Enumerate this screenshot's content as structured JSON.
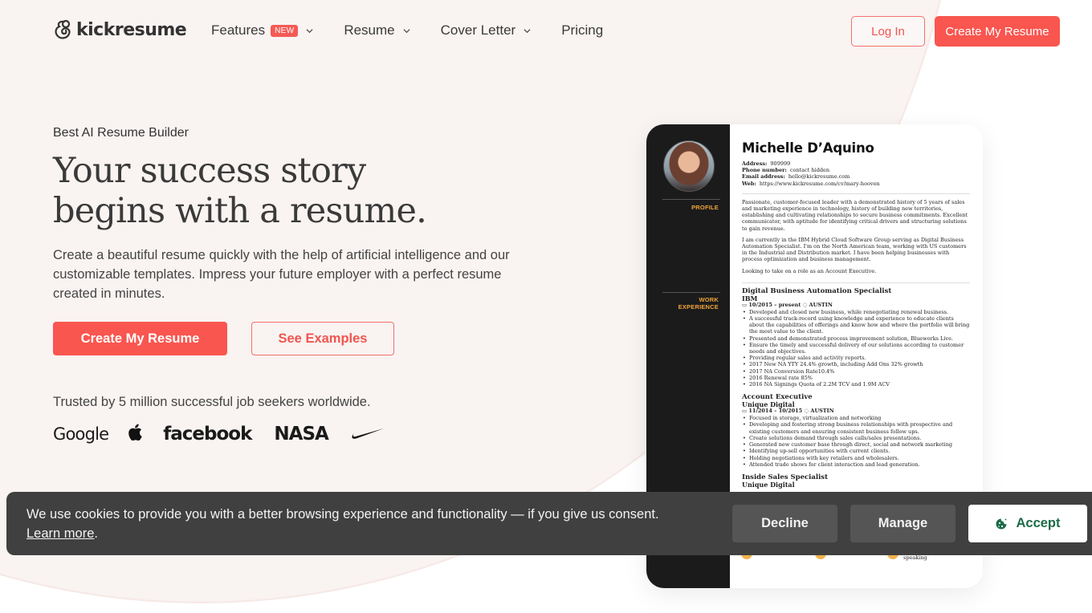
{
  "header": {
    "logo_text": "kickresume",
    "nav": [
      {
        "label": "Features",
        "badge": "NEW",
        "has_dropdown": true
      },
      {
        "label": "Resume",
        "has_dropdown": true
      },
      {
        "label": "Cover Letter",
        "has_dropdown": true
      },
      {
        "label": "Pricing",
        "has_dropdown": false
      }
    ],
    "login_label": "Log In",
    "create_label": "Create My Resume"
  },
  "hero": {
    "eyebrow": "Best AI Resume Builder",
    "headline_line1": "Your success story",
    "headline_line2": "begins with a resume.",
    "subtext": "Create a beautiful resume quickly with the help of artificial intelligence and our customizable templates. Impress your future employer with a perfect resume created in minutes.",
    "primary_cta": "Create My Resume",
    "secondary_cta": "See Examples",
    "trusted_text": "Trusted by 5 million successful job seekers worldwide.",
    "brands": [
      "Google",
      "Apple",
      "facebook",
      "NASA",
      "Nike"
    ]
  },
  "resume": {
    "name": "Michelle D’Aquino",
    "contact": [
      {
        "label": "Address:",
        "value": "909999"
      },
      {
        "label": "Phone number:",
        "value": "contact hidden"
      },
      {
        "label": "Email address:",
        "value": "hello@kickresume.com"
      },
      {
        "label": "Web:",
        "value": "https://www.kickresume.com/cv/mary-hooven"
      }
    ],
    "sections": {
      "profile": "PROFILE",
      "work_1": "WORK",
      "work_2": "EXPERIENCE"
    },
    "profile_paragraphs": [
      "Passionate, customer-focused leader with a demonstrated history of 5 years of sales and marketing experience in technology, history of building new territories, establishing and cultivating relationships to secure business commitments. Excellent communicator, with aptitude for identifying critical drivers and structuring solutions to gain revenue.",
      "I am currently in the IBM Hybrid Cloud Software Group serving as Digital Business Automation Specialist. I'm on the North American team, working with US customers in the Industrial and Distribution market. I have been helping businesses with process optimization and business management.",
      "Looking to take on a role as an Account Executive."
    ],
    "jobs": [
      {
        "title": "Digital Business Automation Specialist",
        "company": "IBM",
        "dates": "10/2015 – present",
        "location": "AUSTIN",
        "bullets": [
          "Developed and closed new business, while renegotiating renewal business.",
          "A successful track-record using knowledge and experience  to educate clients about the capabilities of offerings and know how and where the portfolio will bring the most value to the client.",
          "Presented and demonstrated process improvement solution, Blueworks Live.",
          "Ensure the timely and successful delivery of our solutions according to customer needs and objectives.",
          "Providing regular sales and activity reports.",
          "2017 New NA YTY 24.4% growth, including Add Ons 32% growth",
          "2017 NA Conversion Rate10.4%",
          "2016 Renewal rate 85%",
          "2016 NA Signings Quota of 2.2M TCV and 1.9M ACV"
        ]
      },
      {
        "title": "Account Executive",
        "company": "Unique Digital",
        "dates": "11/2014 – 10/2015",
        "location": "AUSTIN",
        "bullets": [
          "Focused in storage, virtualization and networking",
          "Developing and fostering strong business relationships with prospective and existing customers and ensuring consistent business follow ups.",
          "Create solutions demand through sales calls/sales presentations.",
          "Generated new customer base through direct, social and network marketing",
          "Identifying up-sell opportunities with current clients.",
          "Holding negotiations with key retailers and wholesalers.",
          "Attended trade shows for client interaction and lead generation."
        ]
      },
      {
        "title": "Inside Sales Specialist",
        "company": "Unique Digital",
        "dates": "",
        "location": "",
        "bullets": []
      }
    ],
    "skill_partial": "speaking"
  },
  "cookie": {
    "message": "We use cookies to provide you with a better browsing experience and functionality — if you give us consent.",
    "learn_more": "Learn more",
    "decline": "Decline",
    "manage": "Manage",
    "accept": "Accept"
  },
  "colors": {
    "brand_red": "#f9564f",
    "bg_blush": "#f9f3f1",
    "resume_sidebar": "#1b1b1b",
    "resume_accent": "#f0a43a",
    "cookie_bg": "#404040",
    "accept_text": "#1d6b4a"
  }
}
